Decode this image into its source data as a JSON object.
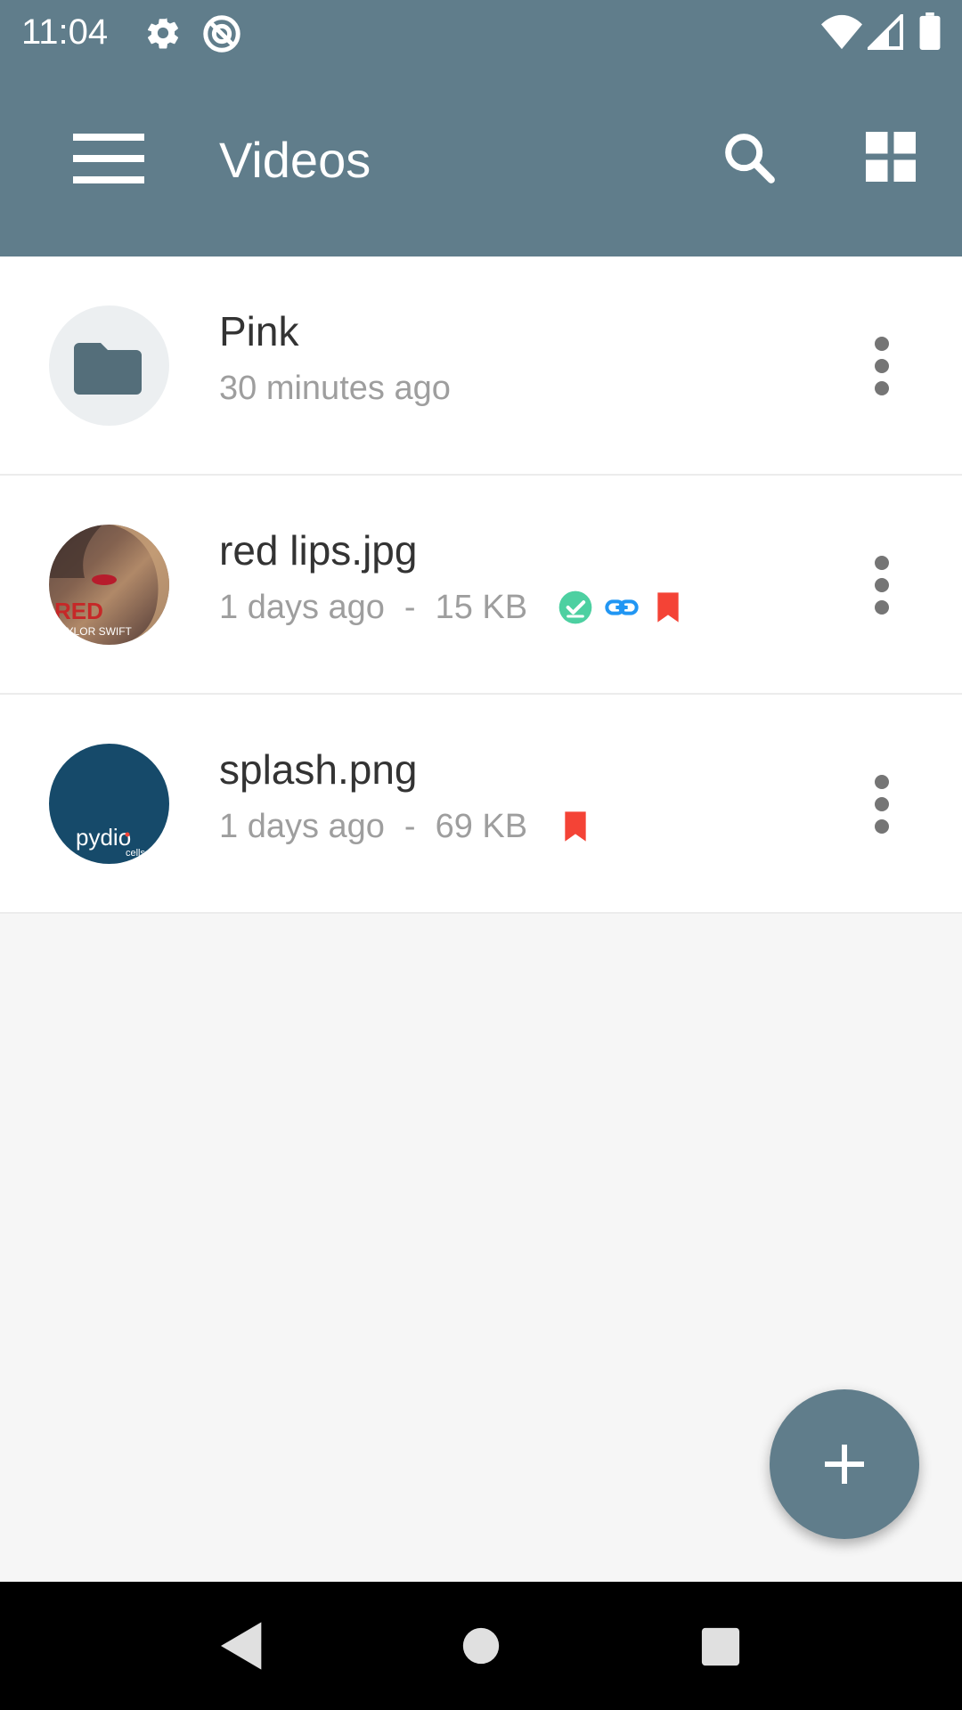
{
  "status_bar": {
    "time": "11:04",
    "icons": [
      "settings-icon",
      "target-icon",
      "wifi-icon",
      "signal-icon",
      "battery-icon"
    ]
  },
  "toolbar": {
    "title": "Videos",
    "actions": [
      "menu-icon",
      "search-icon",
      "grid-view-icon"
    ]
  },
  "files": [
    {
      "name": "Pink",
      "modified": "30 minutes ago",
      "size": "",
      "thumbnail": "folder-icon",
      "badges": []
    },
    {
      "name": "red lips.jpg",
      "modified": "1 days ago",
      "size": "15 KB",
      "separator": "-",
      "thumbnail": "photo-thumbnail",
      "thumbnail_text": [
        "RED",
        "TAYLOR SWIFT"
      ],
      "badges": [
        "synced-check-icon",
        "shared-link-icon",
        "bookmark-icon"
      ]
    },
    {
      "name": "splash.png",
      "modified": "1 days ago",
      "size": "69 KB",
      "separator": "-",
      "thumbnail": "pydio-logo-thumbnail",
      "thumbnail_text": [
        "pydio",
        "cells"
      ],
      "badges": [
        "bookmark-icon"
      ]
    }
  ],
  "fab": {
    "icon": "plus-icon"
  },
  "colors": {
    "primary": "#607d8b",
    "background": "#f6f6f6",
    "synced": "#4dd0a1",
    "link": "#2196f3",
    "bookmark": "#f44336",
    "folder": "#546e7a"
  }
}
